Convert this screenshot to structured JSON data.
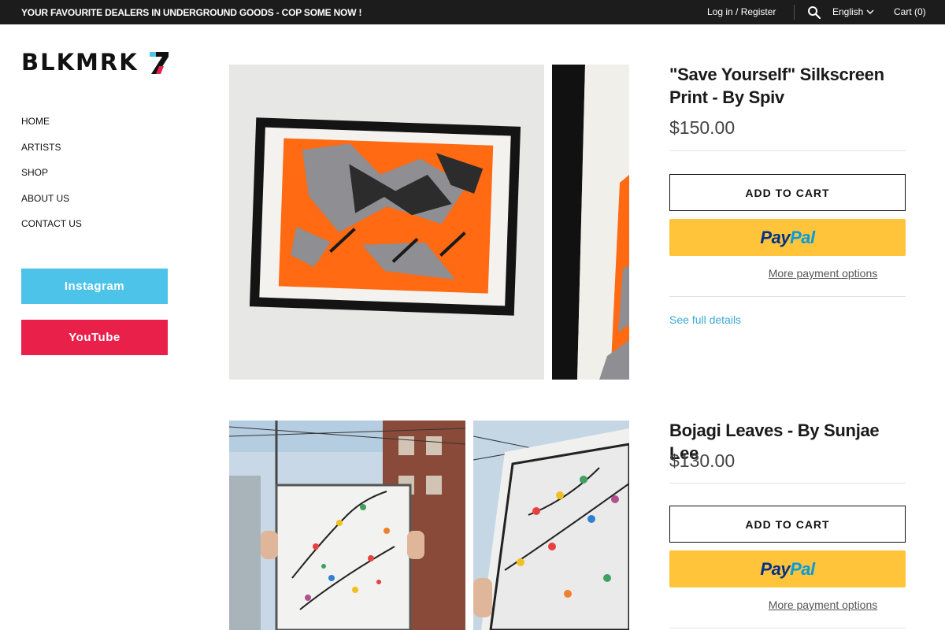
{
  "topbar": {
    "announcement": "YOUR FAVOURITE DEALERS IN UNDERGROUND GOODS - COP SOME NOW !",
    "login": "Log in / Register",
    "language": "English",
    "cart": "Cart (0)"
  },
  "brand": {
    "logo_text": "BLKMRK"
  },
  "nav": {
    "items": [
      {
        "label": "HOME"
      },
      {
        "label": "ARTISTS"
      },
      {
        "label": "SHOP"
      },
      {
        "label": "ABOUT US"
      },
      {
        "label": "CONTACT US"
      }
    ]
  },
  "social": {
    "instagram": "Instagram",
    "youtube": "YouTube"
  },
  "products": [
    {
      "title": "\"Save Yourself\" Silkscreen Print - By Spiv",
      "price": "$150.00",
      "add_to_cart": "ADD TO CART",
      "paypal_1": "Pay",
      "paypal_2": "Pal",
      "more_payment": "More payment options",
      "see_full": "See full details"
    },
    {
      "title": "Bojagi Leaves - By Sunjae Lee",
      "price": "$130.00",
      "add_to_cart": "ADD TO CART",
      "paypal_1": "Pay",
      "paypal_2": "Pal",
      "more_payment": "More payment options"
    }
  ],
  "colors": {
    "topbar_bg": "#1c1c1c",
    "instagram": "#4ec3e9",
    "youtube": "#e8204a",
    "paypal": "#ffc439",
    "link": "#3aa9d6",
    "print_orange": "#ff6a13"
  }
}
